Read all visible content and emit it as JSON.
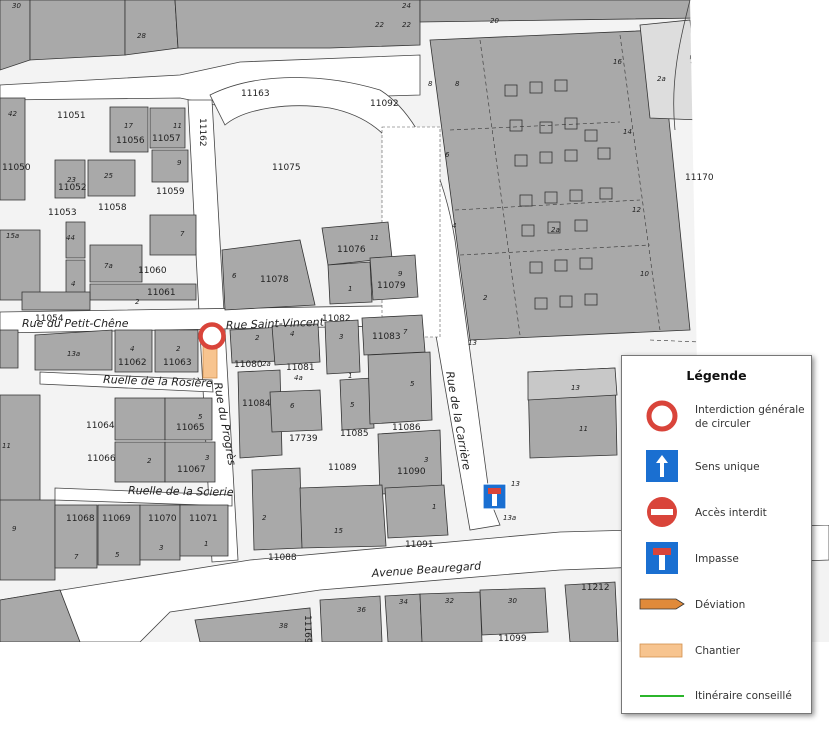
{
  "map": {
    "lots": [
      "11163",
      "11092",
      "11051",
      "11057",
      "11056",
      "11162",
      "11075",
      "11050",
      "11052",
      "11059",
      "11058",
      "11053",
      "11076",
      "11078",
      "11079",
      "11060",
      "11061",
      "11054",
      "11082",
      "11083",
      "11062",
      "11063",
      "11080",
      "11081",
      "11084",
      "11064",
      "11065",
      "11085",
      "11086",
      "17739",
      "11066",
      "11067",
      "11089",
      "11090",
      "11068",
      "11069",
      "11070",
      "11071",
      "11091",
      "11088",
      "11212",
      "11099",
      "11170",
      "11169"
    ],
    "house_numbers": [
      "30",
      "28",
      "24",
      "22",
      "22",
      "20",
      "8",
      "6",
      "8",
      "16",
      "2a",
      "14",
      "42",
      "17",
      "11",
      "23",
      "25",
      "9",
      "4",
      "12",
      "2a",
      "10",
      "15a",
      "44",
      "7",
      "7a",
      "11",
      "2",
      "4",
      "2",
      "6",
      "1",
      "9",
      "7",
      "13",
      "13a",
      "4",
      "2",
      "3",
      "2a",
      "4a",
      "4",
      "6",
      "2",
      "5",
      "13",
      "5",
      "1",
      "5",
      "2",
      "3",
      "11",
      "11",
      "3",
      "13a",
      "1",
      "13",
      "9",
      "7",
      "5",
      "3",
      "1",
      "2",
      "15",
      "36",
      "34",
      "32",
      "30",
      "38"
    ],
    "streets": {
      "rue_petit_chene": "Rue du Petit-Chêne",
      "rue_saint_vincent": "Rue Saint-Vincent",
      "ruelle_rosiere": "Ruelle de la Rosière",
      "rue_du_progres": "Rue du Progrès",
      "rue_de_la_carriere": "Rue de la Carrière",
      "ruelle_de_la_scierie": "Ruelle de la Scierie",
      "avenue_beauregard": "Avenue Beauregard"
    },
    "markers": [
      {
        "type": "interdiction-circuler",
        "location": "Rue du Progrès"
      },
      {
        "type": "impasse",
        "location": "Rue de la Carrière"
      }
    ],
    "chantier": {
      "location": "Rue du Progrès"
    },
    "colors": {
      "building": "#a9a9a9",
      "road": "#ffffff",
      "parcel_line": "#333333",
      "background": "#f2f2f2"
    }
  },
  "legend": {
    "title": "Légende",
    "items": [
      {
        "icon": "prohibition-circle-icon",
        "label_lines": [
          "Interdiction générale",
          "de circuler"
        ],
        "color": "#d9443a"
      },
      {
        "icon": "one-way-arrow-icon",
        "label_lines": [
          "Sens unique"
        ],
        "color": "#1a6fd1"
      },
      {
        "icon": "no-entry-icon",
        "label_lines": [
          "Accès interdit"
        ],
        "color": "#d9443a"
      },
      {
        "icon": "dead-end-icon",
        "label_lines": [
          "Impasse"
        ],
        "color": "#1a6fd1"
      },
      {
        "icon": "detour-arrow-icon",
        "label_lines": [
          "Déviation"
        ],
        "color": "#e08a3a"
      },
      {
        "icon": "construction-area-icon",
        "label_lines": [
          "Chantier"
        ],
        "color": "#f7c48f"
      },
      {
        "icon": "recommended-route-icon",
        "label_lines": [
          "Itinéraire conseillé"
        ],
        "color": "#2bb52b"
      }
    ]
  }
}
